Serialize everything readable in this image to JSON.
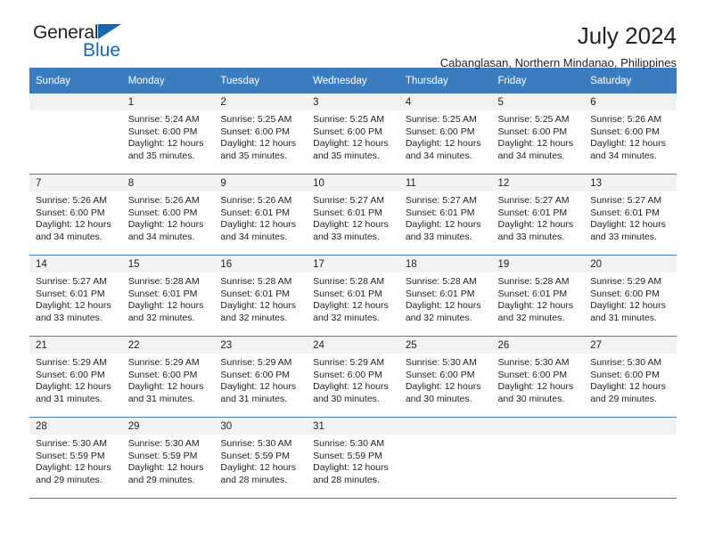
{
  "brand": {
    "name_part1": "General",
    "name_part2": "Blue",
    "triangle_icon": "triangle-icon",
    "accent_color": "#1669b1"
  },
  "header": {
    "month_title": "July 2024",
    "location": "Cabanglasan, Northern Mindanao, Philippines"
  },
  "calendar": {
    "header_bg": "#3a7cbe",
    "daynum_bg": "#f2f2f2",
    "row_border": "#4a7eb0",
    "weekday_headers": [
      "Sunday",
      "Monday",
      "Tuesday",
      "Wednesday",
      "Thursday",
      "Friday",
      "Saturday"
    ],
    "weeks": [
      [
        {
          "day": "",
          "empty": true,
          "sunrise": "",
          "sunset": "",
          "daylight_line1": "",
          "daylight_line2": ""
        },
        {
          "day": "1",
          "sunrise": "Sunrise: 5:24 AM",
          "sunset": "Sunset: 6:00 PM",
          "daylight_line1": "Daylight: 12 hours",
          "daylight_line2": "and 35 minutes."
        },
        {
          "day": "2",
          "sunrise": "Sunrise: 5:25 AM",
          "sunset": "Sunset: 6:00 PM",
          "daylight_line1": "Daylight: 12 hours",
          "daylight_line2": "and 35 minutes."
        },
        {
          "day": "3",
          "sunrise": "Sunrise: 5:25 AM",
          "sunset": "Sunset: 6:00 PM",
          "daylight_line1": "Daylight: 12 hours",
          "daylight_line2": "and 35 minutes."
        },
        {
          "day": "4",
          "sunrise": "Sunrise: 5:25 AM",
          "sunset": "Sunset: 6:00 PM",
          "daylight_line1": "Daylight: 12 hours",
          "daylight_line2": "and 34 minutes."
        },
        {
          "day": "5",
          "sunrise": "Sunrise: 5:25 AM",
          "sunset": "Sunset: 6:00 PM",
          "daylight_line1": "Daylight: 12 hours",
          "daylight_line2": "and 34 minutes."
        },
        {
          "day": "6",
          "sunrise": "Sunrise: 5:26 AM",
          "sunset": "Sunset: 6:00 PM",
          "daylight_line1": "Daylight: 12 hours",
          "daylight_line2": "and 34 minutes."
        }
      ],
      [
        {
          "day": "7",
          "sunrise": "Sunrise: 5:26 AM",
          "sunset": "Sunset: 6:00 PM",
          "daylight_line1": "Daylight: 12 hours",
          "daylight_line2": "and 34 minutes."
        },
        {
          "day": "8",
          "sunrise": "Sunrise: 5:26 AM",
          "sunset": "Sunset: 6:00 PM",
          "daylight_line1": "Daylight: 12 hours",
          "daylight_line2": "and 34 minutes."
        },
        {
          "day": "9",
          "sunrise": "Sunrise: 5:26 AM",
          "sunset": "Sunset: 6:01 PM",
          "daylight_line1": "Daylight: 12 hours",
          "daylight_line2": "and 34 minutes."
        },
        {
          "day": "10",
          "sunrise": "Sunrise: 5:27 AM",
          "sunset": "Sunset: 6:01 PM",
          "daylight_line1": "Daylight: 12 hours",
          "daylight_line2": "and 33 minutes."
        },
        {
          "day": "11",
          "sunrise": "Sunrise: 5:27 AM",
          "sunset": "Sunset: 6:01 PM",
          "daylight_line1": "Daylight: 12 hours",
          "daylight_line2": "and 33 minutes."
        },
        {
          "day": "12",
          "sunrise": "Sunrise: 5:27 AM",
          "sunset": "Sunset: 6:01 PM",
          "daylight_line1": "Daylight: 12 hours",
          "daylight_line2": "and 33 minutes."
        },
        {
          "day": "13",
          "sunrise": "Sunrise: 5:27 AM",
          "sunset": "Sunset: 6:01 PM",
          "daylight_line1": "Daylight: 12 hours",
          "daylight_line2": "and 33 minutes."
        }
      ],
      [
        {
          "day": "14",
          "sunrise": "Sunrise: 5:27 AM",
          "sunset": "Sunset: 6:01 PM",
          "daylight_line1": "Daylight: 12 hours",
          "daylight_line2": "and 33 minutes."
        },
        {
          "day": "15",
          "sunrise": "Sunrise: 5:28 AM",
          "sunset": "Sunset: 6:01 PM",
          "daylight_line1": "Daylight: 12 hours",
          "daylight_line2": "and 32 minutes."
        },
        {
          "day": "16",
          "sunrise": "Sunrise: 5:28 AM",
          "sunset": "Sunset: 6:01 PM",
          "daylight_line1": "Daylight: 12 hours",
          "daylight_line2": "and 32 minutes."
        },
        {
          "day": "17",
          "sunrise": "Sunrise: 5:28 AM",
          "sunset": "Sunset: 6:01 PM",
          "daylight_line1": "Daylight: 12 hours",
          "daylight_line2": "and 32 minutes."
        },
        {
          "day": "18",
          "sunrise": "Sunrise: 5:28 AM",
          "sunset": "Sunset: 6:01 PM",
          "daylight_line1": "Daylight: 12 hours",
          "daylight_line2": "and 32 minutes."
        },
        {
          "day": "19",
          "sunrise": "Sunrise: 5:28 AM",
          "sunset": "Sunset: 6:01 PM",
          "daylight_line1": "Daylight: 12 hours",
          "daylight_line2": "and 32 minutes."
        },
        {
          "day": "20",
          "sunrise": "Sunrise: 5:29 AM",
          "sunset": "Sunset: 6:00 PM",
          "daylight_line1": "Daylight: 12 hours",
          "daylight_line2": "and 31 minutes."
        }
      ],
      [
        {
          "day": "21",
          "sunrise": "Sunrise: 5:29 AM",
          "sunset": "Sunset: 6:00 PM",
          "daylight_line1": "Daylight: 12 hours",
          "daylight_line2": "and 31 minutes."
        },
        {
          "day": "22",
          "sunrise": "Sunrise: 5:29 AM",
          "sunset": "Sunset: 6:00 PM",
          "daylight_line1": "Daylight: 12 hours",
          "daylight_line2": "and 31 minutes."
        },
        {
          "day": "23",
          "sunrise": "Sunrise: 5:29 AM",
          "sunset": "Sunset: 6:00 PM",
          "daylight_line1": "Daylight: 12 hours",
          "daylight_line2": "and 31 minutes."
        },
        {
          "day": "24",
          "sunrise": "Sunrise: 5:29 AM",
          "sunset": "Sunset: 6:00 PM",
          "daylight_line1": "Daylight: 12 hours",
          "daylight_line2": "and 30 minutes."
        },
        {
          "day": "25",
          "sunrise": "Sunrise: 5:30 AM",
          "sunset": "Sunset: 6:00 PM",
          "daylight_line1": "Daylight: 12 hours",
          "daylight_line2": "and 30 minutes."
        },
        {
          "day": "26",
          "sunrise": "Sunrise: 5:30 AM",
          "sunset": "Sunset: 6:00 PM",
          "daylight_line1": "Daylight: 12 hours",
          "daylight_line2": "and 30 minutes."
        },
        {
          "day": "27",
          "sunrise": "Sunrise: 5:30 AM",
          "sunset": "Sunset: 6:00 PM",
          "daylight_line1": "Daylight: 12 hours",
          "daylight_line2": "and 29 minutes."
        }
      ],
      [
        {
          "day": "28",
          "sunrise": "Sunrise: 5:30 AM",
          "sunset": "Sunset: 5:59 PM",
          "daylight_line1": "Daylight: 12 hours",
          "daylight_line2": "and 29 minutes."
        },
        {
          "day": "29",
          "sunrise": "Sunrise: 5:30 AM",
          "sunset": "Sunset: 5:59 PM",
          "daylight_line1": "Daylight: 12 hours",
          "daylight_line2": "and 29 minutes."
        },
        {
          "day": "30",
          "sunrise": "Sunrise: 5:30 AM",
          "sunset": "Sunset: 5:59 PM",
          "daylight_line1": "Daylight: 12 hours",
          "daylight_line2": "and 28 minutes."
        },
        {
          "day": "31",
          "sunrise": "Sunrise: 5:30 AM",
          "sunset": "Sunset: 5:59 PM",
          "daylight_line1": "Daylight: 12 hours",
          "daylight_line2": "and 28 minutes."
        },
        {
          "day": "",
          "empty": true,
          "sunrise": "",
          "sunset": "",
          "daylight_line1": "",
          "daylight_line2": ""
        },
        {
          "day": "",
          "empty": true,
          "sunrise": "",
          "sunset": "",
          "daylight_line1": "",
          "daylight_line2": ""
        },
        {
          "day": "",
          "empty": true,
          "sunrise": "",
          "sunset": "",
          "daylight_line1": "",
          "daylight_line2": ""
        }
      ]
    ]
  }
}
